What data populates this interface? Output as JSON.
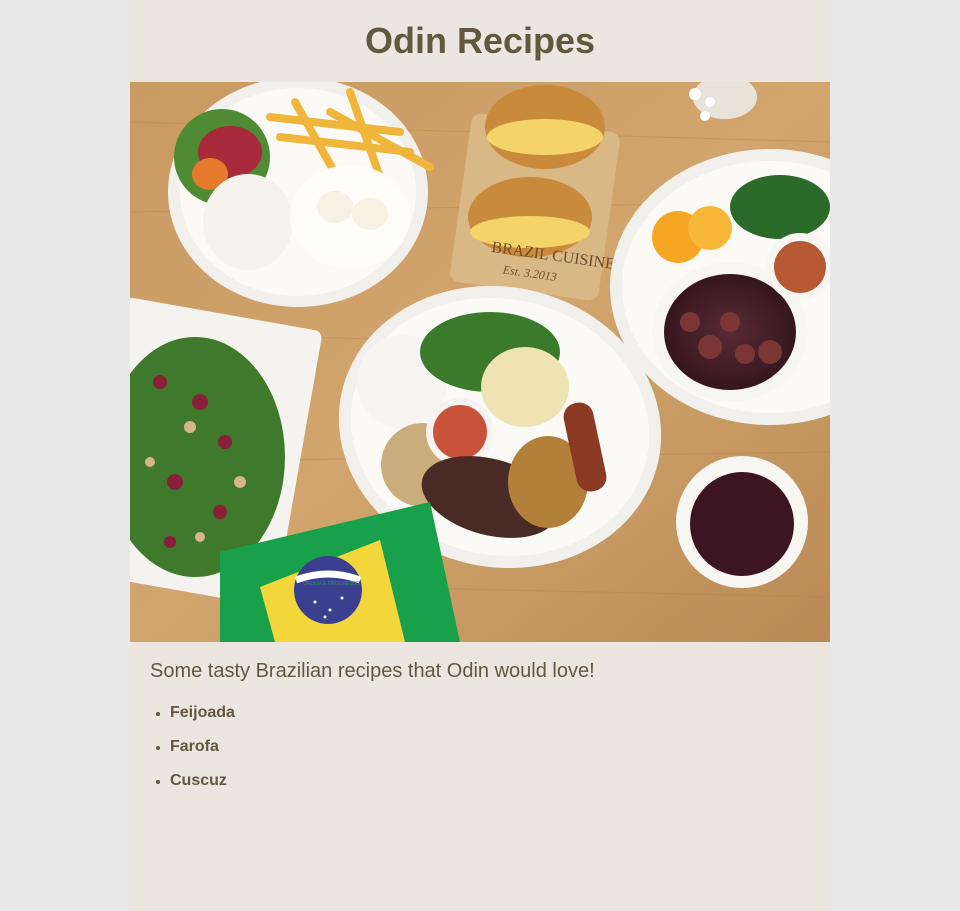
{
  "header": {
    "title": "Odin Recipes"
  },
  "hero": {
    "description": "Overhead photo of Brazilian dishes on a wooden table",
    "board_engraving": [
      "BRAZIL CUISINE",
      "Est. 3.2013"
    ],
    "flag_motto": "ORDEM E PROGRESSO",
    "colors": {
      "table": "#c89a63",
      "flag_green": "#18a04a",
      "flag_yellow": "#f2d63a",
      "flag_blue": "#3b3f8f"
    }
  },
  "intro": "Some tasty Brazilian recipes that Odin would love!",
  "recipes": [
    {
      "label": "Feijoada"
    },
    {
      "label": "Farofa"
    },
    {
      "label": "Cuscuz"
    }
  ],
  "colors": {
    "text": "#625840",
    "page_bg": "#ece6e1",
    "outer_bg": "#e9e8e8"
  }
}
